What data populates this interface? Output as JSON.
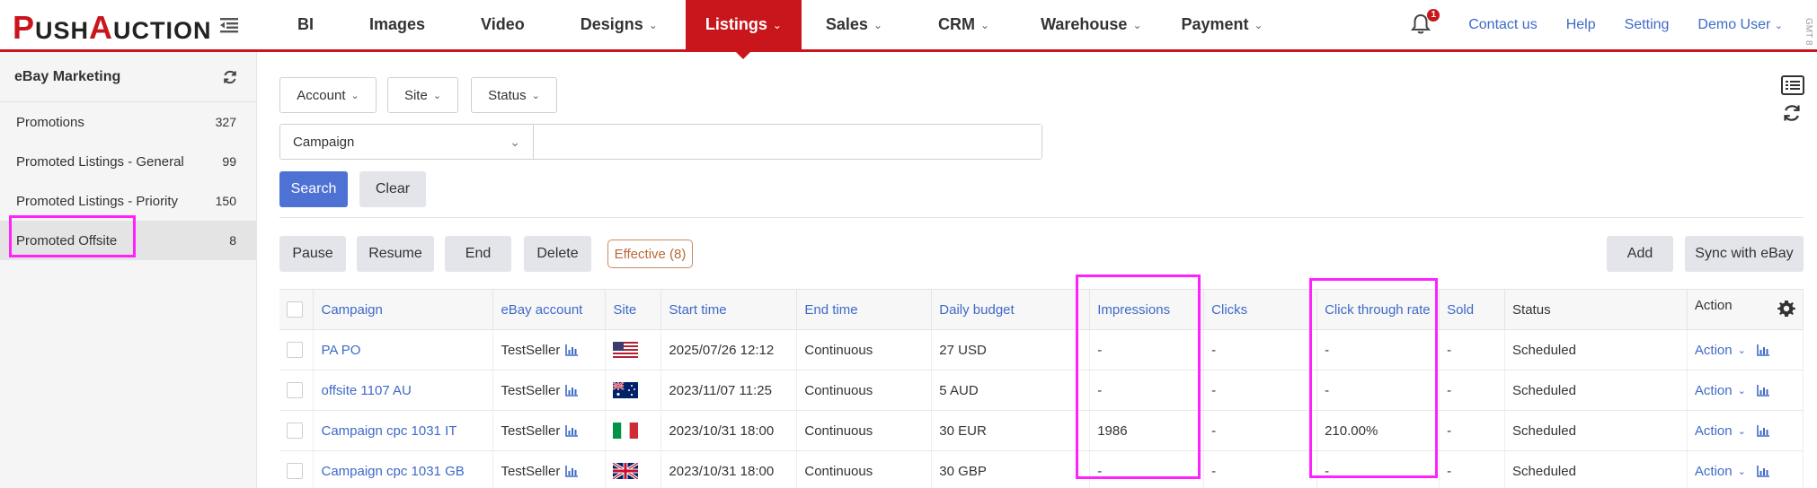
{
  "app": {
    "logo_p": "P",
    "logo_ush": "USH",
    "logo_a": "A",
    "logo_uction": "UCTION",
    "timezone": "GMT 8"
  },
  "nav": [
    {
      "label": "BI",
      "dropdown": false
    },
    {
      "label": "Images",
      "dropdown": false
    },
    {
      "label": "Video",
      "dropdown": false
    },
    {
      "label": "Designs",
      "dropdown": true
    },
    {
      "label": "Listings",
      "dropdown": true,
      "active": true
    },
    {
      "label": "Sales",
      "dropdown": true
    },
    {
      "label": "CRM",
      "dropdown": true
    },
    {
      "label": "Warehouse",
      "dropdown": true
    },
    {
      "label": "Payment",
      "dropdown": true
    }
  ],
  "header_right": {
    "notification_count": "1",
    "contact": "Contact us",
    "help": "Help",
    "setting": "Setting",
    "user": "Demo User"
  },
  "sidebar": {
    "title": "eBay Marketing",
    "items": [
      {
        "label": "Promotions",
        "count": "327"
      },
      {
        "label": "Promoted Listings - General",
        "count": "99"
      },
      {
        "label": "Promoted Listings - Priority",
        "count": "150"
      },
      {
        "label": "Promoted Offsite",
        "count": "8",
        "active": true
      }
    ]
  },
  "filters": {
    "account": "Account",
    "site": "Site",
    "status": "Status"
  },
  "search": {
    "field": "Campaign",
    "value": "",
    "search_label": "Search",
    "clear_label": "Clear"
  },
  "toolbar": {
    "pause": "Pause",
    "resume": "Resume",
    "end": "End",
    "delete": "Delete",
    "effective": "Effective (8)",
    "add": "Add",
    "sync": "Sync with eBay"
  },
  "table": {
    "headers": [
      "Campaign",
      "eBay account",
      "Site",
      "Start time",
      "End time",
      "Daily budget",
      "Impressions",
      "Clicks",
      "Click through rate",
      "Sold",
      "Status",
      "Action"
    ],
    "rows": [
      {
        "campaign": "PA PO",
        "account": "TestSeller",
        "site_flag": "us-flag",
        "start": "2025/07/26 12:12",
        "end": "Continuous",
        "budget": "27 USD",
        "impressions": "-",
        "clicks": "-",
        "ctr": "-",
        "sold": "-",
        "status": "Scheduled",
        "action": "Action"
      },
      {
        "campaign": "offsite 1107 AU",
        "account": "TestSeller",
        "site_flag": "au-flag",
        "start": "2023/11/07 11:25",
        "end": "Continuous",
        "budget": "5 AUD",
        "impressions": "-",
        "clicks": "-",
        "ctr": "-",
        "sold": "-",
        "status": "Scheduled",
        "action": "Action"
      },
      {
        "campaign": "Campaign cpc 1031 IT",
        "account": "TestSeller",
        "site_flag": "it-flag",
        "start": "2023/10/31 18:00",
        "end": "Continuous",
        "budget": "30 EUR",
        "impressions": "1986",
        "clicks": "-",
        "ctr": "210.00%",
        "sold": "-",
        "status": "Scheduled",
        "action": "Action"
      },
      {
        "campaign": "Campaign cpc 1031 GB",
        "account": "TestSeller",
        "site_flag": "gb-flag",
        "start": "2023/10/31 18:00",
        "end": "Continuous",
        "budget": "30 GBP",
        "impressions": "-",
        "clicks": "-",
        "ctr": "-",
        "sold": "-",
        "status": "Scheduled",
        "action": "Action"
      }
    ]
  },
  "colors": {
    "brand_red": "#c9161d",
    "link_blue": "#3e6ac8",
    "primary_button": "#4e71d4",
    "highlight": "#ff22ff"
  }
}
